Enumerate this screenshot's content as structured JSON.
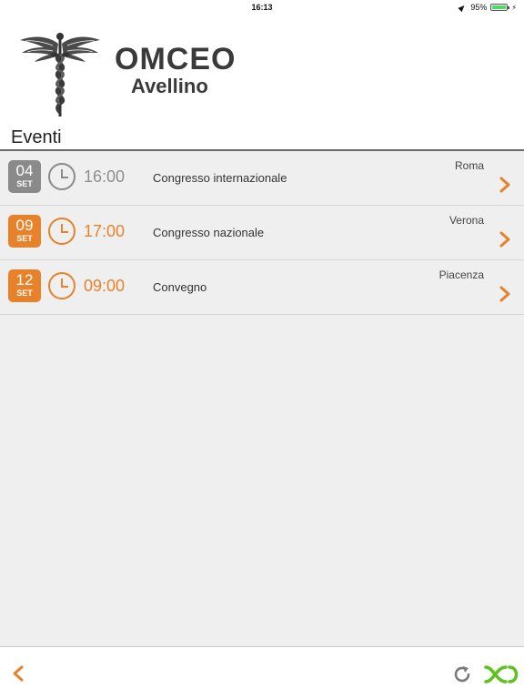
{
  "status_bar": {
    "time": "16:13",
    "battery_text": "95%",
    "battery_level": 0.95,
    "battery_color": "#4cd964"
  },
  "header": {
    "title": "OMCEO",
    "subtitle": "Avellino",
    "emblem_icon": "caduceus-icon"
  },
  "section": {
    "title": "Eventi"
  },
  "events": [
    {
      "day": "04",
      "month": "SET",
      "time": "16:00",
      "title": "Congresso internazionale",
      "city": "Roma",
      "state": "gray"
    },
    {
      "day": "09",
      "month": "SET",
      "time": "17:00",
      "title": "Congresso nazionale",
      "city": "Verona",
      "state": "orange"
    },
    {
      "day": "12",
      "month": "SET",
      "time": "09:00",
      "title": "Convegno",
      "city": "Piacenza",
      "state": "orange"
    }
  ],
  "colors": {
    "accent": "#e8822a",
    "past": "#8a8a8a",
    "brand_green": "#5cc21d"
  },
  "toolbar": {
    "back_icon": "chevron-left-icon",
    "refresh_icon": "refresh-icon",
    "brand_icon": "brand-logo-icon"
  }
}
